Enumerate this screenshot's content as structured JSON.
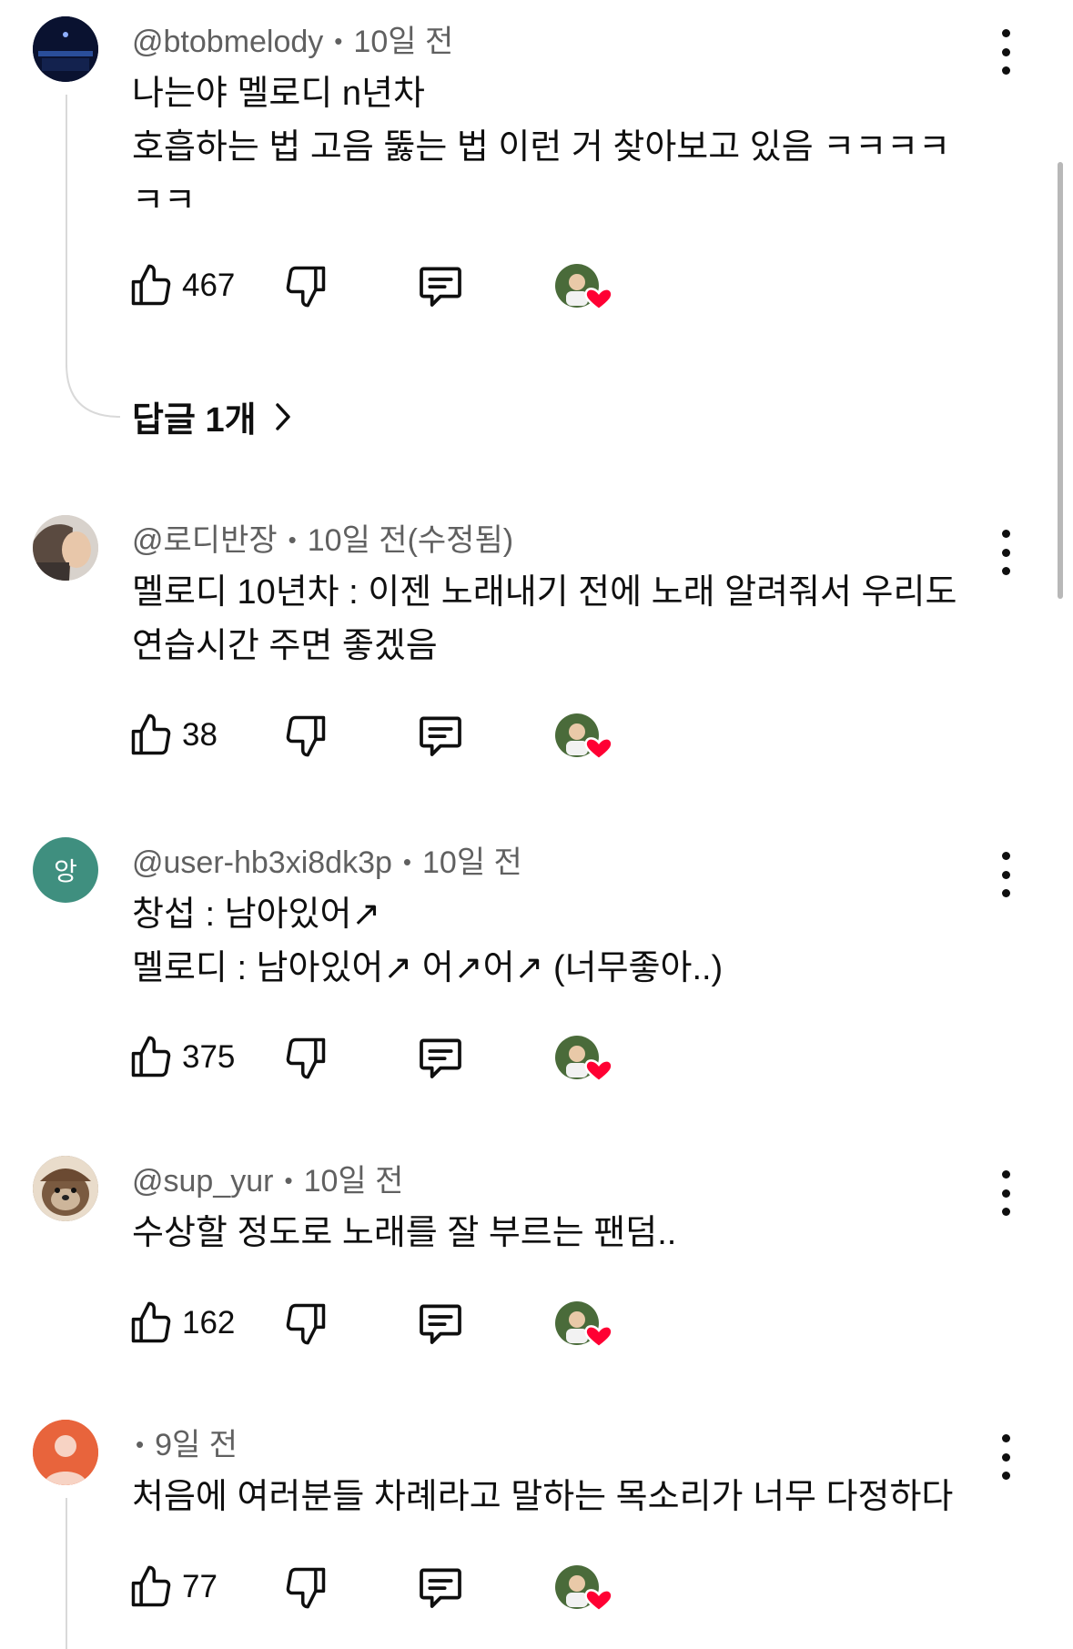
{
  "comments": [
    {
      "handle": "@btobmelody",
      "time": "10일 전",
      "lines": [
        "나는야 멜로디 n년차",
        "호흡하는 법 고음 뚫는 법 이런 거 찾아보고 있음 ㅋㅋㅋㅋ",
        "ㅋㅋ"
      ],
      "likes": "467",
      "avatar": "concert-stage"
    },
    {
      "handle": "@로디반장",
      "time": "10일 전(수정됨)",
      "lines": [
        "멜로디 10년차 : 이젠 노래내기 전에 노래 알려줘서 우리도",
        "연습시간 주면 좋겠음"
      ],
      "likes": "38",
      "avatar": "photo"
    },
    {
      "handle": "@user-hb3xi8dk3p",
      "time": "10일 전",
      "lines": [
        "창섭 : 남아있어↗",
        "멜로디 : 남아있어↗ 어↗어↗ (너무좋아..)"
      ],
      "likes": "375",
      "avatar_letter": "앙"
    },
    {
      "handle": "@sup_yur",
      "time": "10일 전",
      "lines": [
        "수상할 정도로 노래를 잘 부르는 팬덤.."
      ],
      "likes": "162",
      "avatar": "otter"
    },
    {
      "handle": "",
      "time": "9일 전",
      "lines": [
        "처음에 여러분들 차례라고 말하는 목소리가 너무 다정하다"
      ],
      "likes": "77",
      "avatar": "default-person"
    }
  ],
  "reply_link": "답글 1개",
  "colors": {
    "text": "#0f0f0f",
    "meta": "#606060",
    "heart": "#ff0033",
    "letter_avatar": "#3f8f7f",
    "default_avatar": "#e8643c"
  }
}
